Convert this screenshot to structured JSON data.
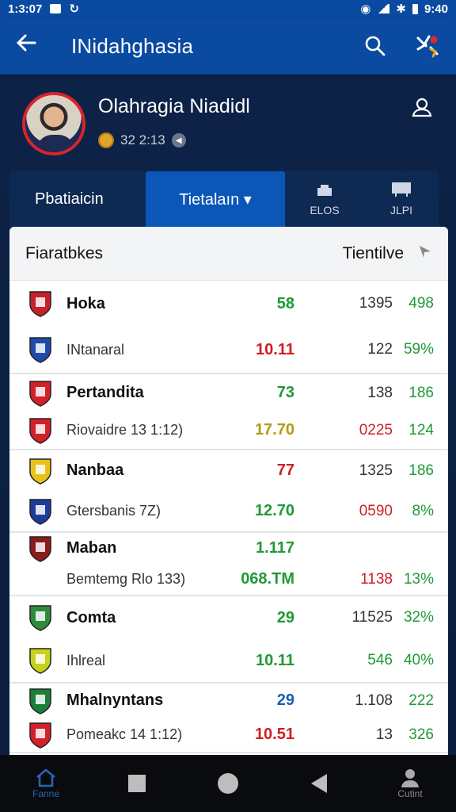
{
  "status_bar": {
    "time_left": "1:3:07",
    "time_right": "9:40"
  },
  "app_bar": {
    "title": "INidahghasia"
  },
  "profile": {
    "name": "Olahragia Niadidl",
    "meta": "32 2:13"
  },
  "tabs": [
    {
      "label": "Pbatiaicin"
    },
    {
      "label": "Tietalaın ▾"
    },
    {
      "label": "ELOS"
    },
    {
      "label": "JLPI"
    }
  ],
  "table_header": {
    "left": "Fiaratbkes",
    "right": "Tientilve"
  },
  "matches": [
    {
      "home": {
        "name": "Hoka",
        "crest": "#c8202a",
        "v1": "58",
        "v1_color": "green",
        "v2": "1395",
        "v3": "498",
        "v3_color": "green"
      },
      "away": {
        "name": "INtanaral",
        "crest": "#1f4aa8",
        "v1": "10.11",
        "v1_color": "red",
        "v2": "122",
        "v3": "59%",
        "v3_color": "green"
      }
    },
    {
      "home": {
        "name": "Pertandita",
        "crest": "#d42028",
        "v1": "73",
        "v1_color": "green",
        "v2": "138",
        "v3": "186",
        "v3_color": "green"
      },
      "away": {
        "name": "Riovaidre 13 1:12)",
        "crest": "#d42028",
        "v1": "17.70",
        "v1_color": "mixed",
        "v2": "0225",
        "v2_color": "red",
        "v3": "124",
        "v3_color": "green"
      }
    },
    {
      "home": {
        "name": "Nanbaa",
        "crest": "#e8c21a",
        "v1": "77",
        "v1_color": "red",
        "v2": "1325",
        "v3": "186",
        "v3_color": "green"
      },
      "away": {
        "name": "Gtersbanis 7Z)",
        "crest": "#1d3c9a",
        "v1": "12.70",
        "v1_color": "green",
        "v2": "0590",
        "v2_color": "red",
        "v3": "8%",
        "v3_color": "green"
      }
    },
    {
      "home": {
        "name": "Maban",
        "crest": "#8a1c1c",
        "v1": "1.117",
        "v1_color": "green",
        "v2": "",
        "v3": "",
        "v3_color": "green"
      },
      "away": {
        "name": "Bemtemg Rlo 133)",
        "crest": "",
        "v1": "068.TM",
        "v1_color": "green",
        "v2": "1138",
        "v2_color": "red",
        "v3": "13%",
        "v3_color": "green"
      }
    },
    {
      "home": {
        "name": "Comta",
        "crest": "#2e8b3c",
        "v1": "29",
        "v1_color": "green",
        "v2": "11525",
        "v3": "32%",
        "v3_color": "green"
      },
      "away": {
        "name": "Ihlreal",
        "crest": "#c7d21b",
        "v1": "10.11",
        "v1_color": "green",
        "v2": "546",
        "v2_color": "green",
        "v3": "40%",
        "v3_color": "green"
      }
    },
    {
      "home": {
        "name": "Mhalnyntans",
        "crest": "#1a7f3a",
        "v1": "29",
        "v1_color": "blue",
        "v2": "1.108",
        "v3": "222",
        "v3_color": "green"
      },
      "away": {
        "name": "Pomeakc 14 1:12)",
        "crest": "#d42028",
        "v1": "10.51",
        "v1_color": "red",
        "v2": "13",
        "v3": "326",
        "v3_color": "green"
      }
    }
  ],
  "nav": [
    {
      "label": "Fanne"
    },
    {
      "label": ""
    },
    {
      "label": ""
    },
    {
      "label": ""
    },
    {
      "label": "Cutint"
    }
  ],
  "colors": {
    "primary": "#0a4aa0",
    "accent_red": "#d11d22",
    "accent_green": "#1f9a35",
    "dark_bg": "#0d2348"
  }
}
